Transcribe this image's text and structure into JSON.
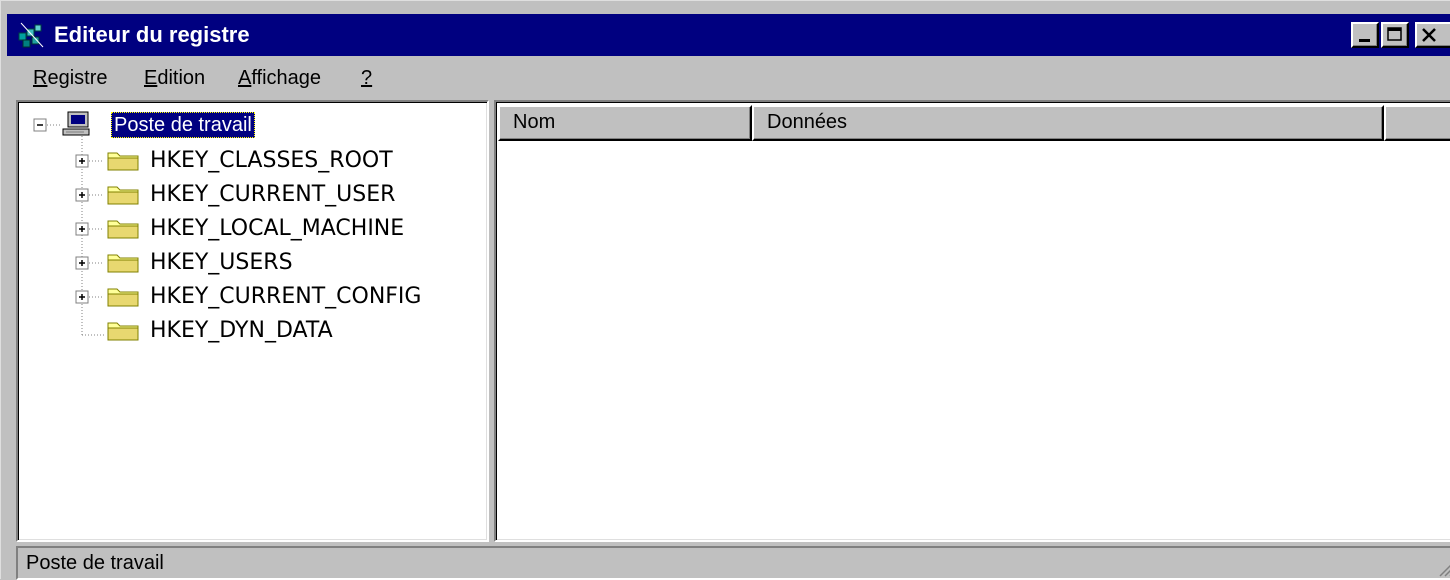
{
  "window": {
    "title": "Editeur du registre",
    "title_bar_color": "#000080",
    "controls": [
      "minimize-icon",
      "maximize-icon",
      "close-icon"
    ]
  },
  "menu": [
    {
      "accel": "R",
      "rest": "egistre"
    },
    {
      "accel": "E",
      "rest": "dition"
    },
    {
      "accel": "A",
      "rest": "ffichage"
    },
    {
      "accel": "?",
      "rest": ""
    }
  ],
  "tree": {
    "root": {
      "label": "Poste de travail",
      "icon": "computer-icon",
      "expanded": true,
      "selected": true
    },
    "children": [
      {
        "label": "HKEY_CLASSES_ROOT",
        "icon": "folder-icon",
        "expandable": true
      },
      {
        "label": "HKEY_CURRENT_USER",
        "icon": "folder-icon",
        "expandable": true
      },
      {
        "label": "HKEY_LOCAL_MACHINE",
        "icon": "folder-icon",
        "expandable": true
      },
      {
        "label": "HKEY_USERS",
        "icon": "folder-icon",
        "expandable": true
      },
      {
        "label": "HKEY_CURRENT_CONFIG",
        "icon": "folder-icon",
        "expandable": true
      },
      {
        "label": "HKEY_DYN_DATA",
        "icon": "folder-icon",
        "expandable": false
      }
    ]
  },
  "list": {
    "columns": [
      "Nom",
      "Données",
      ""
    ],
    "rows": []
  },
  "status": {
    "text": "Poste de travail"
  }
}
